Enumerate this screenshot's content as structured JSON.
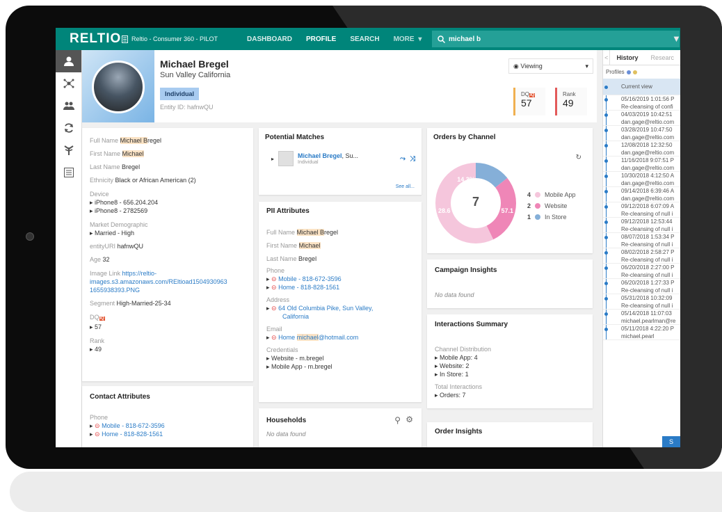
{
  "topbar": {
    "logo": "RELTIO",
    "tenant": "Reltio - Consumer 360 - PILOT",
    "nav": [
      "DASHBOARD",
      "PROFILE",
      "SEARCH",
      "MORE"
    ],
    "search_value": "michael b"
  },
  "profile": {
    "name": "Michael Bregel",
    "location": "Sun Valley California",
    "type": "Individual",
    "entity_id": "Entity ID: hafnwQU",
    "viewing": "Viewing",
    "dq_label": "DQ",
    "dq_badge": "IQ",
    "dq_value": "57",
    "rank_label": "Rank",
    "rank_value": "49"
  },
  "attributes": {
    "full_name_label": "Full Name",
    "full_name_hl": "Michael B",
    "full_name_rest": "regel",
    "first_name_label": "First Name",
    "first_name": "Michael",
    "last_name_label": "Last Name",
    "last_name": "Bregel",
    "ethnicity_label": "Ethnicity",
    "ethnicity": "Black or African American (2)",
    "device_label": "Device",
    "device_1": "iPhone8 - 656.204.204",
    "device_2": "iPhone8 - 2782569",
    "market_label": "Market Demographic",
    "market": "Married - High",
    "entityuri_label": "entityURI",
    "entityuri": "hafnwQU",
    "age_label": "Age",
    "age": "32",
    "image_label": "Image Link",
    "image_link_1": "https://reltio-",
    "image_link_2": "images.s3.amazonaws.com/REltioad1504930963",
    "image_link_3": "1655938393.PNG",
    "segment_label": "Segment",
    "segment": "High-Married-25-34",
    "dq_label": "DQ",
    "dq_badge": "IQ",
    "dq": "57",
    "rank_label": "Rank",
    "rank": "49"
  },
  "contact": {
    "title": "Contact Attributes",
    "phone_label": "Phone",
    "phone_1": "Mobile - 818-672-3596",
    "phone_2": "Home - 818-828-1561"
  },
  "potential_matches": {
    "title": "Potential Matches",
    "name": "Michael Bregel",
    "name_suffix": ", Su...",
    "type": "Individual",
    "see_all": "See all..."
  },
  "pii": {
    "title": "PII Attributes",
    "full_name_label": "Full Name",
    "full_name_hl": "Michael B",
    "full_name_rest": "regel",
    "first_name_label": "First Name",
    "first_name": "Michael",
    "last_name_label": "Last Name",
    "last_name": "Bregel",
    "phone_label": "Phone",
    "phone_1": "Mobile - 818-672-3596",
    "phone_2": "Home - 818-828-1561",
    "address_label": "Address",
    "address_1": "64 Old Columbia Pike, Sun Valley,",
    "address_2": "California",
    "email_label": "Email",
    "email_prefix": "Home ",
    "email_hl": "michael",
    "email_rest": "@hotmail.com",
    "credentials_label": "Credentials",
    "cred_1": "Website - m.bregel",
    "cred_2": "Mobile App - m.bregel"
  },
  "households": {
    "title": "Households",
    "empty": "No data found"
  },
  "orders": {
    "title": "Orders by Channel",
    "total": "7",
    "label_1": "14.3%",
    "label_2": "28.6",
    "label_3": "57.1"
  },
  "chart_data": {
    "type": "pie",
    "title": "Orders by Channel",
    "categories": [
      "Mobile App",
      "Website",
      "In Store"
    ],
    "values": [
      4,
      2,
      1
    ],
    "colors": [
      "#f5c6dc",
      "#ef86b7",
      "#85afd8"
    ]
  },
  "campaign": {
    "title": "Campaign Insights",
    "empty": "No data found"
  },
  "interactions": {
    "title": "Interactions Summary",
    "channel_label": "Channel Distribution",
    "ch_1": "Mobile App: 4",
    "ch_2": "Website: 2",
    "ch_3": "In Store: 1",
    "total_label": "Total Interactions",
    "total": "Orders: 7"
  },
  "order_insights": {
    "title": "Order Insights"
  },
  "history": {
    "tab_history": "History",
    "tab_research": "Researc",
    "profiles_label": "Profiles",
    "current": "Current view",
    "button": "S",
    "items": [
      {
        "date": "05/16/2019 1:01:56 P",
        "note": "Re-cleansing of confi"
      },
      {
        "date": "04/03/2019 10:42:51",
        "note": "dan.gage@reltio.com"
      },
      {
        "date": "03/28/2019 10:47:50",
        "note": "dan.gage@reltio.com"
      },
      {
        "date": "12/08/2018 12:32:50",
        "note": "dan.gage@reltio.com"
      },
      {
        "date": "11/16/2018 9:07:51 P",
        "note": "dan.gage@reltio.com"
      },
      {
        "date": "10/30/2018 4:12:50 A",
        "note": "dan.gage@reltio.com"
      },
      {
        "date": "09/14/2018 6:39:46 A",
        "note": "dan.gage@reltio.com"
      },
      {
        "date": "09/12/2018 6:07:09 A",
        "note": "Re-cleansing of null i"
      },
      {
        "date": "09/12/2018 12:53:44",
        "note": "Re-cleansing of null i"
      },
      {
        "date": "08/07/2018 1:53:34 P",
        "note": "Re-cleansing of null i"
      },
      {
        "date": "08/02/2018 2:58:27 P",
        "note": "Re-cleansing of null i"
      },
      {
        "date": "06/20/2018 2:27:00 P",
        "note": "Re-cleansing of null i"
      },
      {
        "date": "06/20/2018 1:27:33 P",
        "note": "Re-cleansing of null i"
      },
      {
        "date": "05/31/2018 10:32:09",
        "note": "Re-cleansing of null i"
      },
      {
        "date": "05/14/2018 11:07:03",
        "note": "michael.pearlman@re"
      },
      {
        "date": "05/11/2018 4:22:20 P",
        "note": "michael.pearl"
      }
    ]
  }
}
